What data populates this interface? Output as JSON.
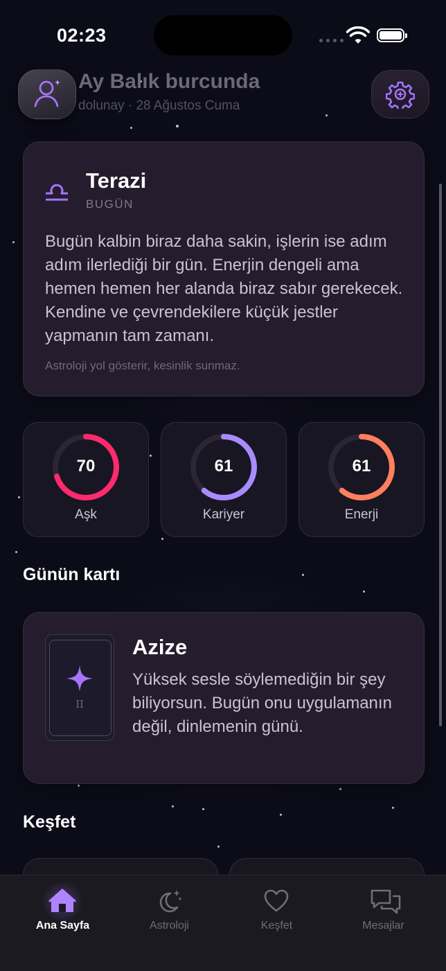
{
  "status_bar": {
    "time": "02:23"
  },
  "header": {
    "title": "Ay Balık burcunda",
    "subtitle": "dolunay · 28 Ağustos Cuma"
  },
  "horoscope": {
    "sign": "Terazi",
    "period": "BUGÜN",
    "text": "Bugün kalbin biraz daha sakin, işlerin ise adım adım ilerlediği bir gün. Enerjin dengeli ama hemen hemen her alanda biraz sabır gerekecek. Kendine ve çevrendekilere küçük jestler yapmanın tam zamanı.",
    "disclaimer": "Astroloji yol gösterir, kesinlik sunmaz."
  },
  "scores": [
    {
      "label": "Aşk",
      "value": "70",
      "fraction": 0.7,
      "color": "#ff2a6d"
    },
    {
      "label": "Kariyer",
      "value": "61",
      "fraction": 0.61,
      "color": "#a98bff"
    },
    {
      "label": "Enerji",
      "value": "61",
      "fraction": 0.61,
      "color": "#ff7f5c"
    }
  ],
  "daily_card": {
    "section_title": "Günün kartı",
    "card_name": "Azize",
    "card_numeral": "II",
    "text": "Yüksek sesle söylemediğin bir şey biliyorsun. Bugün onu uygulamanın değil, dinlemenin günü."
  },
  "explore": {
    "section_title": "Keşfet"
  },
  "tabbar": {
    "tabs": [
      {
        "label": "Ana Sayfa",
        "icon": "home-icon",
        "active": true
      },
      {
        "label": "Astroloji",
        "icon": "moon-stars-icon",
        "active": false
      },
      {
        "label": "Keşfet",
        "icon": "heart-icon",
        "active": false
      },
      {
        "label": "Mesajlar",
        "icon": "chat-bubbles-icon",
        "active": false
      }
    ]
  },
  "colors": {
    "background": "#0b0c17",
    "card": "#251c2e",
    "accent": "#a070ff"
  }
}
